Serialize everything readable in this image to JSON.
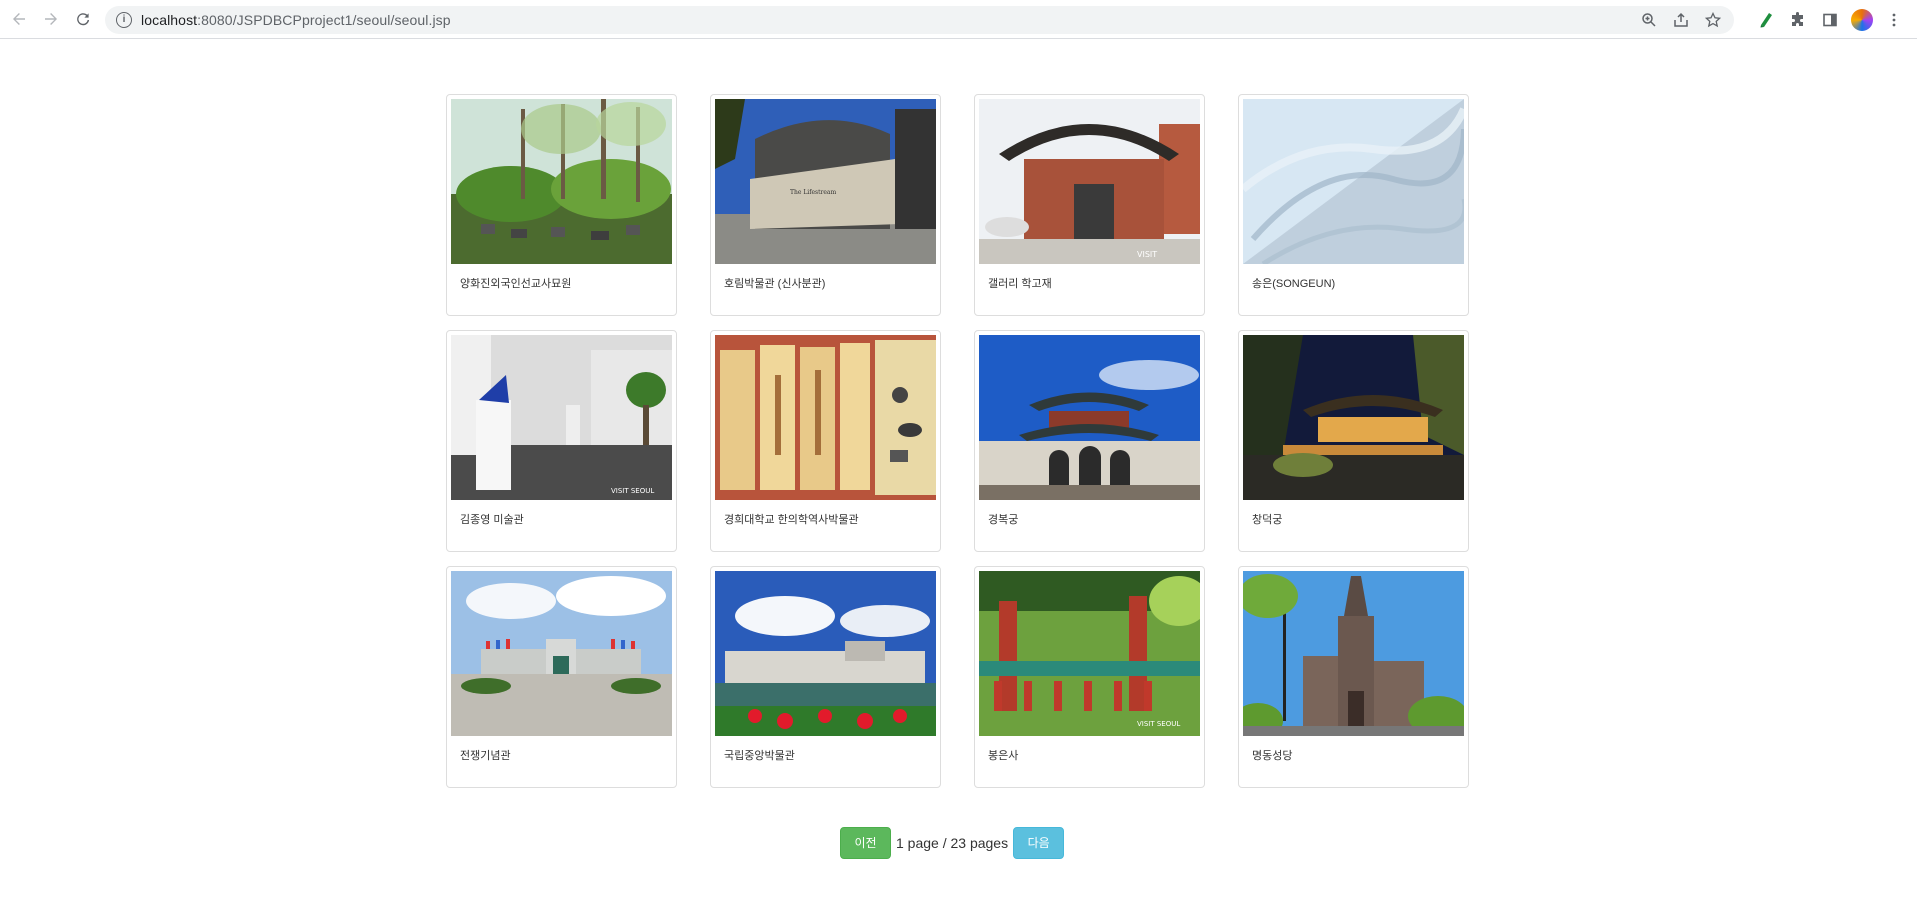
{
  "browser": {
    "url_host": "localhost",
    "url_rest": ":8080/JSPDBCPproject1/seoul/seoul.jsp",
    "icons": [
      "back-icon",
      "forward-icon",
      "reload-icon",
      "site-info-icon",
      "zoom-icon",
      "share-icon",
      "bookmark-star-icon",
      "extension-pen-icon",
      "extensions-puzzle-icon",
      "side-panel-icon",
      "profile-avatar",
      "kebab-menu-icon"
    ]
  },
  "places": [
    {
      "name": "양화진외국인선교사묘원",
      "photo": "cemetery-trees-photo"
    },
    {
      "name": "호림박물관 (신사분관)",
      "photo": "curved-museum-building-photo"
    },
    {
      "name": "갤러리 학고재",
      "photo": "hanok-brick-gallery-photo"
    },
    {
      "name": "송은(SONGEUN)",
      "photo": "marble-wall-photo"
    },
    {
      "name": "김종영 미술관",
      "photo": "white-gallery-interior-photo"
    },
    {
      "name": "경희대학교 한의학역사박물관",
      "photo": "museum-display-panels-photo"
    },
    {
      "name": "경복궁",
      "photo": "palace-gate-photo"
    },
    {
      "name": "창덕궁",
      "photo": "palace-night-photo"
    },
    {
      "name": "전쟁기념관",
      "photo": "memorial-hall-plaza-photo"
    },
    {
      "name": "국립중앙박물관",
      "photo": "national-museum-lake-photo"
    },
    {
      "name": "봉은사",
      "photo": "temple-pavilion-photo"
    },
    {
      "name": "명동성당",
      "photo": "cathedral-photo"
    }
  ],
  "pagination": {
    "prev_label": "이전",
    "page_info": "1 page / 23 pages",
    "next_label": "다음",
    "current_page": 1,
    "total_pages": 23
  },
  "colors": {
    "prev_button": "#5cb85c",
    "next_button": "#5bc0de",
    "card_border": "#dddddd"
  }
}
